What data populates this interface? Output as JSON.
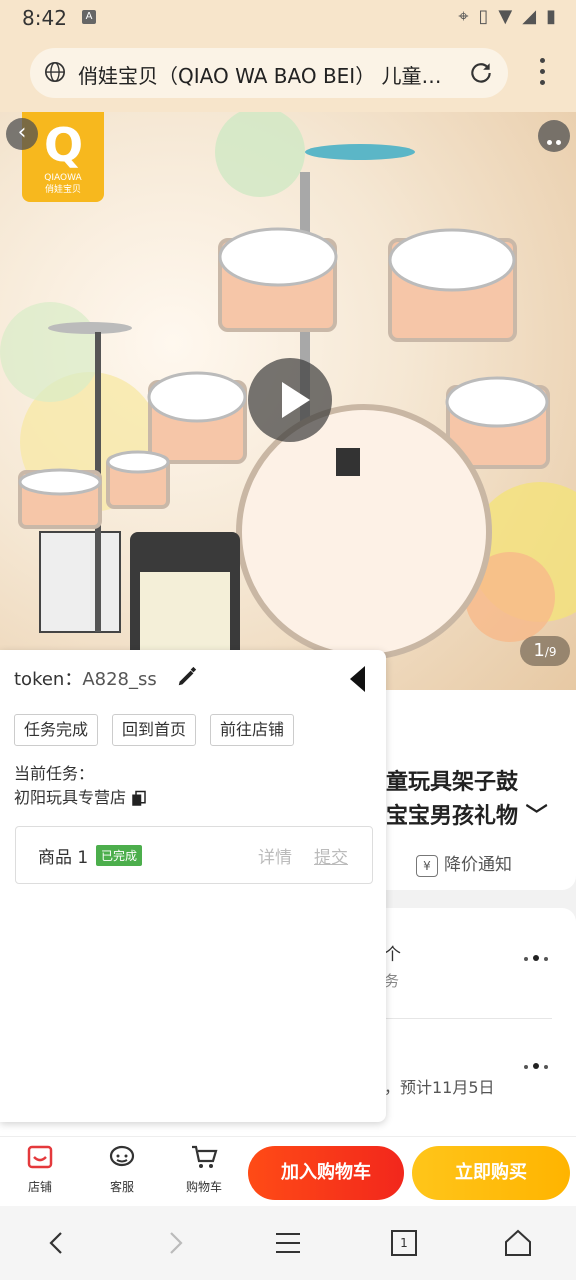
{
  "status_bar": {
    "time": "8:42",
    "notification_badge": "A"
  },
  "browser": {
    "page_title": "俏娃宝贝（QIAO WA BAO BEI） 儿童…",
    "icons": {
      "site": "globe-icon",
      "reload": "reload-icon",
      "menu": "kebab-menu-icon"
    }
  },
  "hero": {
    "logo_letter": "Q",
    "logo_brand_en": "QIAOWA",
    "logo_brand_cn": "俏娃宝贝",
    "image_counter": {
      "current": "1",
      "total": "/9"
    }
  },
  "task_panel": {
    "token_label": "token：",
    "token_value": "A828_ss",
    "buttons": [
      "任务完成",
      "回到首页",
      "前往店铺"
    ],
    "current_task_label": "当前任务：",
    "current_task_value": "初阳玩具专营店",
    "item": {
      "name": "商品 1",
      "status": "已完成",
      "detail": "详情",
      "submit": "提交"
    }
  },
  "product": {
    "title_line1": "童玩具架子鼓",
    "title_line2": "宝宝男孩礼物",
    "price_notice": "降价通知",
    "service_row1": "个",
    "service_row1_sub": "务",
    "delivery_row": "，预计11月5日"
  },
  "bottom_bar": {
    "store": "店铺",
    "service": "客服",
    "cart": "购物车",
    "add_to_cart": "加入购物车",
    "buy_now": "立即购买"
  },
  "nav_bar": {
    "tab_count": "1"
  },
  "colors": {
    "accent_red": "#f2271c",
    "accent_yellow": "#ffb400",
    "status_green": "#4cae4c",
    "status_bg": "#f7e5cb"
  }
}
